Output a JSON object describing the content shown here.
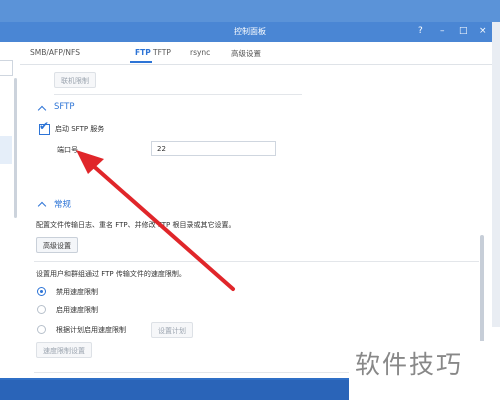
{
  "window": {
    "title": "控制面板",
    "controls": [
      "?",
      "–",
      "□",
      "×"
    ]
  },
  "tabs": [
    {
      "label": "SMB/AFP/NFS",
      "active": false
    },
    {
      "label": "FTP",
      "active": true
    },
    {
      "label": "TFTP",
      "active": false
    },
    {
      "label": "rsync",
      "active": false
    },
    {
      "label": "高级设置",
      "active": false
    }
  ],
  "top_button": {
    "label": "联机限制"
  },
  "sftp": {
    "title": "SFTP",
    "enable_label": "启动 SFTP 服务",
    "enabled": true,
    "port_label": "端口号",
    "port_value": "22"
  },
  "general": {
    "title": "常规",
    "desc1": "配置文件传输日志、重名 FTP、并修改 FTP 根目录或其它设置。",
    "advanced_button": "高级设置",
    "desc2": "设置用户和群组通过 FTP 传输文件的速度限制。",
    "radio_options": [
      {
        "label": "禁用速度限制",
        "selected": true
      },
      {
        "label": "启用速度限制",
        "selected": false
      },
      {
        "label": "根据计划启用速度限制",
        "selected": false
      }
    ],
    "schedule_button": "设置计划",
    "speed_button": "速度限制设置"
  },
  "watermark": {
    "text": "软件技巧"
  },
  "colors": {
    "accent": "#2d74d6",
    "titlebar": "#4a86d4",
    "arrow": "#e0262a"
  }
}
